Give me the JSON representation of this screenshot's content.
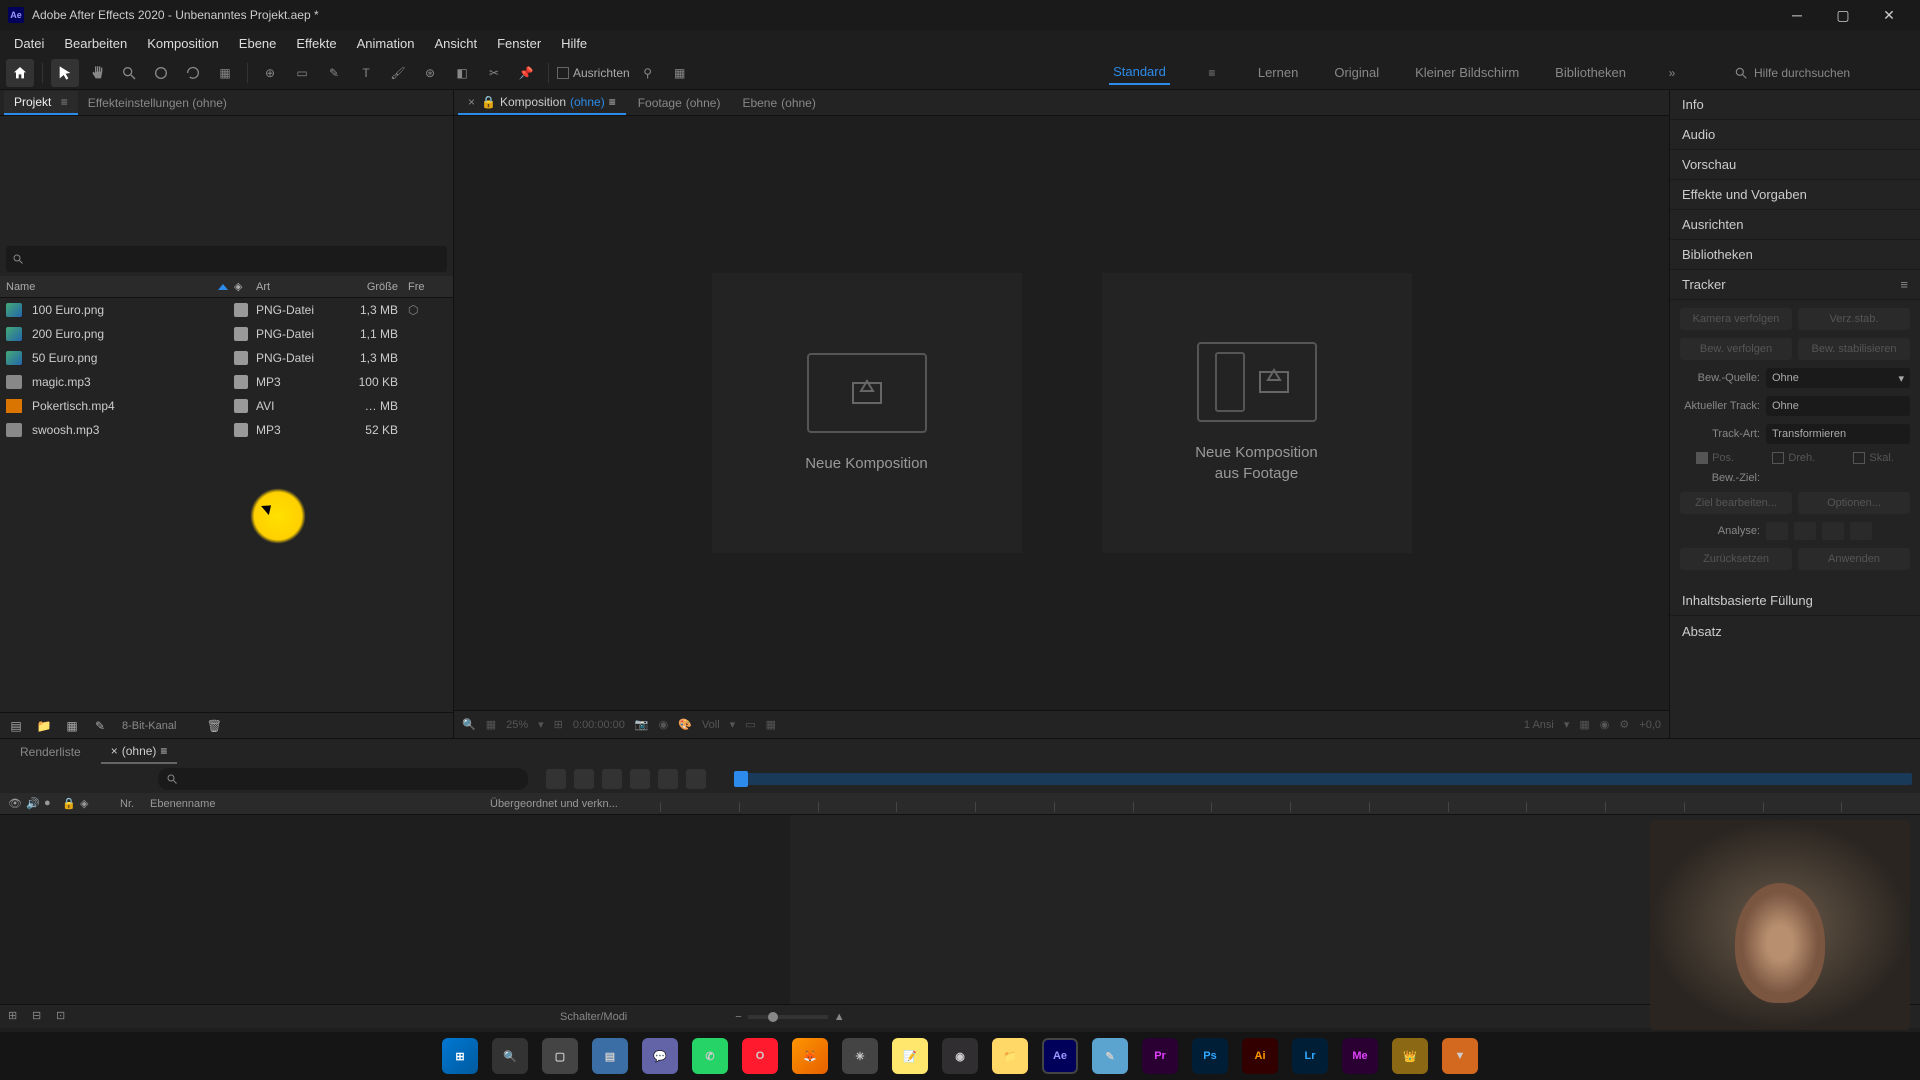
{
  "titlebar": {
    "app_icon": "Ae",
    "title": "Adobe After Effects 2020 - Unbenanntes Projekt.aep *"
  },
  "menu": [
    "Datei",
    "Bearbeiten",
    "Komposition",
    "Ebene",
    "Effekte",
    "Animation",
    "Ansicht",
    "Fenster",
    "Hilfe"
  ],
  "toolbar": {
    "ausrichten": "Ausrichten",
    "workspaces": [
      "Standard",
      "Lernen",
      "Original",
      "Kleiner Bildschirm",
      "Bibliotheken"
    ],
    "active_workspace": "Standard",
    "search_placeholder": "Hilfe durchsuchen"
  },
  "project_panel": {
    "tabs": {
      "projekt": "Projekt",
      "effekt": "Effekteinstellungen (ohne)"
    },
    "columns": {
      "name": "Name",
      "art": "Art",
      "groesse": "Größe",
      "fr": "Fre"
    },
    "rows": [
      {
        "name": "100 Euro.png",
        "type": "PNG-Datei",
        "size": "1,3 MB",
        "icon": "img",
        "used": true
      },
      {
        "name": "200 Euro.png",
        "type": "PNG-Datei",
        "size": "1,1 MB",
        "icon": "img",
        "used": false
      },
      {
        "name": "50 Euro.png",
        "type": "PNG-Datei",
        "size": "1,3 MB",
        "icon": "img",
        "used": false
      },
      {
        "name": "magic.mp3",
        "type": "MP3",
        "size": "100 KB",
        "icon": "aud",
        "used": false
      },
      {
        "name": "Pokertisch.mp4",
        "type": "AVI",
        "size": "… MB",
        "icon": "vid",
        "used": false
      },
      {
        "name": "swoosh.mp3",
        "type": "MP3",
        "size": "52 KB",
        "icon": "aud",
        "used": false
      }
    ],
    "footer_label": "8-Bit-Kanal"
  },
  "comp_panel": {
    "tabs": [
      {
        "prefix": "Komposition",
        "suffix": "(ohne)",
        "active": true,
        "closable": true,
        "lock": true
      },
      {
        "prefix": "Footage",
        "suffix": "(ohne)",
        "active": false
      },
      {
        "prefix": "Ebene",
        "suffix": "(ohne)",
        "active": false
      }
    ],
    "card_new": "Neue Komposition",
    "card_footage_l1": "Neue Komposition",
    "card_footage_l2": "aus Footage",
    "footer": {
      "zoom": "25%",
      "time": "0:00:00:00",
      "res": "Voll",
      "views": "1 Ansi",
      "exposure": "+0,0"
    }
  },
  "right_panels": {
    "simple": [
      "Info",
      "Audio",
      "Vorschau",
      "Effekte und Vorgaben",
      "Ausrichten",
      "Bibliotheken"
    ],
    "tracker": {
      "title": "Tracker",
      "kamera": "Kamera verfolgen",
      "warp": "Verz.stab.",
      "bew_verfolgen": "Bew. verfolgen",
      "bew_stab": "Bew. stabilisieren",
      "quelle_label": "Bew.-Quelle:",
      "quelle_val": "Ohne",
      "track_label": "Aktueller Track:",
      "track_val": "Ohne",
      "art_label": "Track-Art:",
      "art_val": "Transformieren",
      "pos": "Pos.",
      "dreh": "Dreh.",
      "skal": "Skal.",
      "ziel_label": "Bew.-Ziel:",
      "ziel_bearb": "Ziel bearbeiten...",
      "optionen": "Optionen...",
      "analyse": "Analyse:",
      "zuruck": "Zurücksetzen",
      "anwenden": "Anwenden"
    },
    "inhalts": "Inhaltsbasierte Füllung",
    "absatz": "Absatz"
  },
  "timeline": {
    "tabs": {
      "render": "Renderliste",
      "ohne": "(ohne)"
    },
    "header": {
      "nr": "Nr.",
      "name": "Ebenenname",
      "parent": "Übergeordnet und verkn..."
    },
    "footer_text": "Schalter/Modi"
  }
}
